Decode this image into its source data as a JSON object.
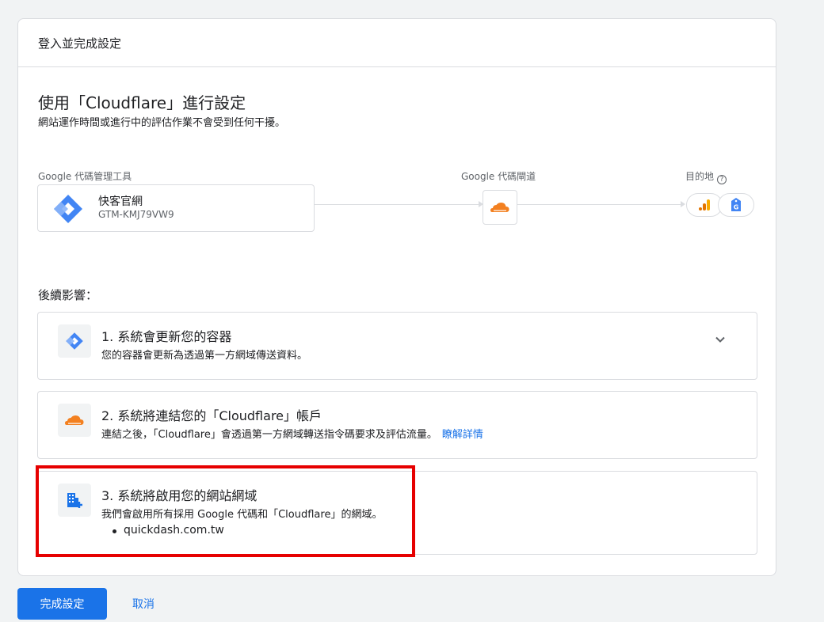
{
  "header": {
    "title": "登入並完成設定"
  },
  "intro": {
    "title": "使用「Cloudflare」進行設定",
    "subtitle": "網站運作時間或進行中的評估作業不會受到任何干擾。"
  },
  "flow": {
    "source_label": "Google 代碼管理工具",
    "container_name": "快客官網",
    "container_id": "GTM-KMJ79VW9",
    "gateway_label": "Google 代碼閘道",
    "destination_label": "目的地",
    "help_icon": "?"
  },
  "effects": {
    "title": "後續影響：",
    "items": [
      {
        "title": "1. 系統會更新您的容器",
        "desc": "您的容器會更新為透過第一方網域傳送資料。"
      },
      {
        "title": "2. 系統將連結您的「Cloudflare」帳戶",
        "desc": "連結之後，「Cloudflare」會透過第一方網域轉送指令碼要求及評估流量。",
        "link": "瞭解詳情"
      },
      {
        "title": "3. 系統將啟用您的網站網域",
        "desc": "我們會啟用所有採用 Google 代碼和「Cloudflare」的網域。",
        "domains": [
          "quickdash.com.tw"
        ]
      }
    ]
  },
  "actions": {
    "primary": "完成設定",
    "cancel": "取消"
  },
  "colors": {
    "accent": "#1a73e8",
    "highlight": "#e60000",
    "cloudflare": "#f38020"
  }
}
